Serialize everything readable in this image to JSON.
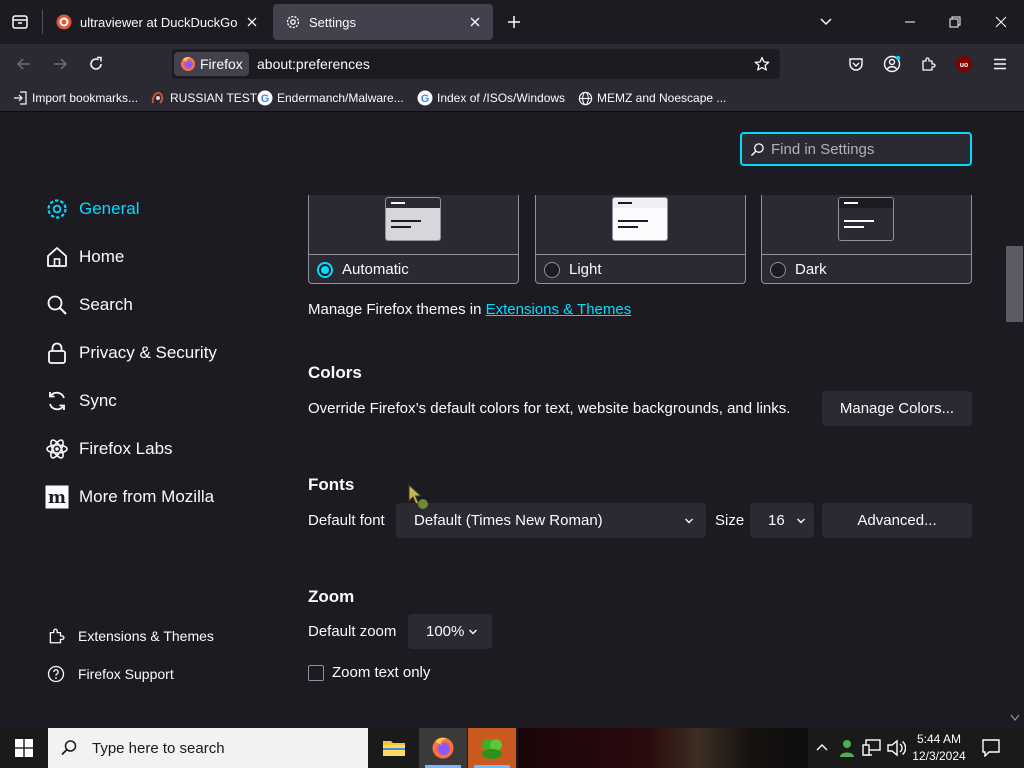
{
  "tabs": [
    {
      "title": "ultraviewer at DuckDuckGo",
      "active": false
    },
    {
      "title": "Settings",
      "active": true
    }
  ],
  "urlbar": {
    "identity": "Firefox",
    "url": "about:preferences"
  },
  "bookmarks": [
    {
      "label": "Import bookmarks...",
      "icon": "import-icon"
    },
    {
      "label": "RUSSIAN TEST",
      "icon": "russian-test-favicon"
    },
    {
      "label": "Endermanch/Malware...",
      "icon": "google-favicon"
    },
    {
      "label": "Index of /ISOs/Windows",
      "icon": "google-favicon"
    },
    {
      "label": "MEMZ and Noescape ...",
      "icon": "globe-icon"
    }
  ],
  "search": {
    "placeholder": "Find in Settings"
  },
  "categories": [
    {
      "label": "General",
      "icon": "gear-icon",
      "selected": true
    },
    {
      "label": "Home",
      "icon": "home-icon",
      "selected": false
    },
    {
      "label": "Search",
      "icon": "search-icon",
      "selected": false
    },
    {
      "label": "Privacy & Security",
      "icon": "lock-icon",
      "selected": false
    },
    {
      "label": "Sync",
      "icon": "sync-icon",
      "selected": false
    },
    {
      "label": "Firefox Labs",
      "icon": "labs-icon",
      "selected": false
    },
    {
      "label": "More from Mozilla",
      "icon": "mozilla-icon",
      "selected": false
    }
  ],
  "footer": [
    {
      "label": "Extensions & Themes",
      "icon": "puzzle-icon"
    },
    {
      "label": "Firefox Support",
      "icon": "help-icon"
    }
  ],
  "themes": [
    {
      "label": "Automatic",
      "selected": true
    },
    {
      "label": "Light",
      "selected": false
    },
    {
      "label": "Dark",
      "selected": false
    }
  ],
  "manage_themes": {
    "text": "Manage Firefox themes in",
    "link": "Extensions & Themes"
  },
  "colors": {
    "heading": "Colors",
    "description": "Override Firefox’s default colors for text, website backgrounds, and links.",
    "button": "Manage Colors..."
  },
  "fonts": {
    "heading": "Fonts",
    "default_label": "Default font",
    "default_value": "Default (Times New Roman)",
    "size_label": "Size",
    "size_value": "16",
    "advanced_button": "Advanced..."
  },
  "zoom": {
    "heading": "Zoom",
    "default_label": "Default zoom",
    "default_value": "100%",
    "text_only_label": "Zoom text only",
    "text_only_checked": false
  },
  "taskbar": {
    "search_placeholder": "Type here to search",
    "time": "5:44 AM",
    "date": "12/3/2024"
  },
  "colors_theme": {
    "accent": "#00ddff",
    "bg": "#1c1b22",
    "surface": "#2b2a33"
  }
}
